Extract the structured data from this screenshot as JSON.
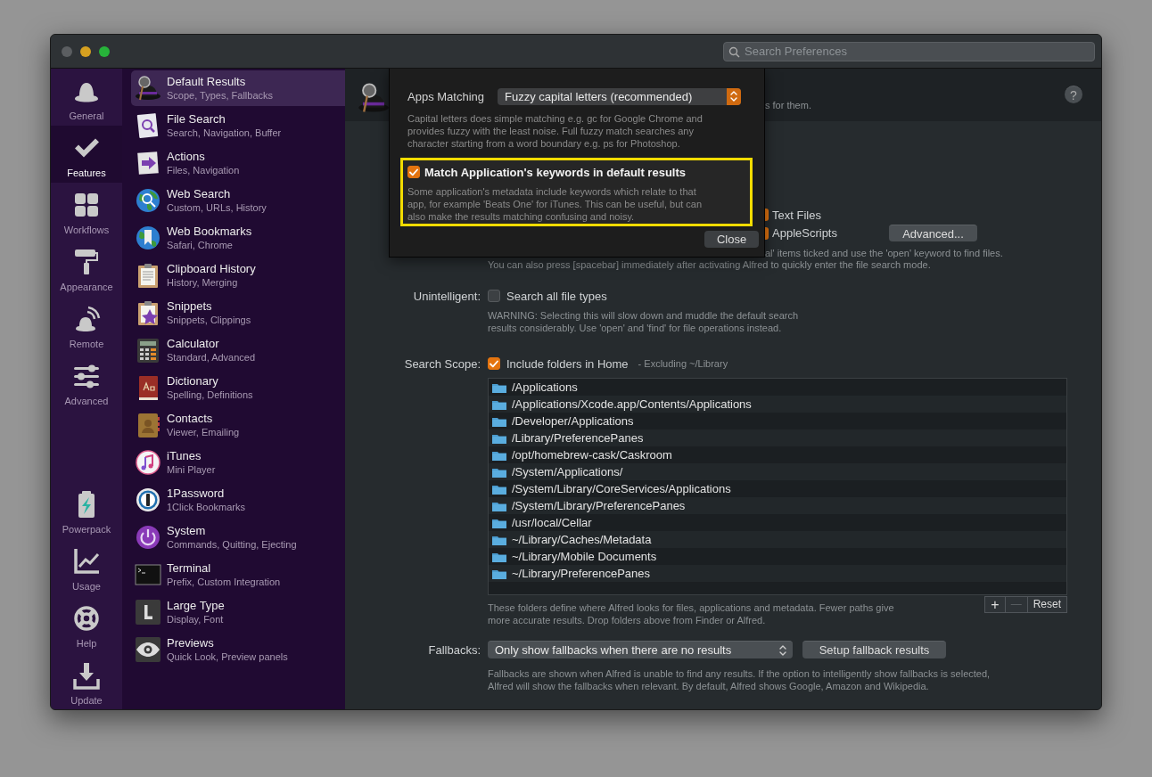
{
  "window": {
    "search": {
      "placeholder": "Search Preferences"
    }
  },
  "sidebar": {
    "items": [
      {
        "label": "General",
        "selected": false
      },
      {
        "label": "Features",
        "selected": true
      },
      {
        "label": "Workflows",
        "selected": false
      },
      {
        "label": "Appearance",
        "selected": false
      },
      {
        "label": "Remote",
        "selected": false
      },
      {
        "label": "Advanced",
        "selected": false
      }
    ],
    "bottom_items": [
      {
        "label": "Powerpack",
        "selected": false
      },
      {
        "label": "Usage",
        "selected": false
      },
      {
        "label": "Help",
        "selected": false
      },
      {
        "label": "Update",
        "selected": false
      }
    ]
  },
  "features": {
    "items": [
      {
        "title": "Default Results",
        "subtitle": "Scope, Types, Fallbacks",
        "selected": true
      },
      {
        "title": "File Search",
        "subtitle": "Search, Navigation, Buffer",
        "selected": false
      },
      {
        "title": "Actions",
        "subtitle": "Files, Navigation",
        "selected": false
      },
      {
        "title": "Web Search",
        "subtitle": "Custom, URLs, History",
        "selected": false
      },
      {
        "title": "Web Bookmarks",
        "subtitle": "Safari, Chrome",
        "selected": false
      },
      {
        "title": "Clipboard History",
        "subtitle": "History, Merging",
        "selected": false
      },
      {
        "title": "Snippets",
        "subtitle": "Snippets, Clippings",
        "selected": false
      },
      {
        "title": "Calculator",
        "subtitle": "Standard, Advanced",
        "selected": false
      },
      {
        "title": "Dictionary",
        "subtitle": "Spelling, Definitions",
        "selected": false
      },
      {
        "title": "Contacts",
        "subtitle": "Viewer, Emailing",
        "selected": false
      },
      {
        "title": "iTunes",
        "subtitle": "Mini Player",
        "selected": false
      },
      {
        "title": "1Password",
        "subtitle": "1Click Bookmarks",
        "selected": false
      },
      {
        "title": "System",
        "subtitle": "Commands, Quitting, Ejecting",
        "selected": false
      },
      {
        "title": "Terminal",
        "subtitle": "Prefix, Custom Integration",
        "selected": false
      },
      {
        "title": "Large Type",
        "subtitle": "Display, Font",
        "selected": false
      },
      {
        "title": "Previews",
        "subtitle": "Quick Look, Preview panels",
        "selected": false
      }
    ]
  },
  "header": {
    "text": "s for them.",
    "help_button": "?"
  },
  "file_types": [
    {
      "label": "Text Files",
      "checked": true
    },
    {
      "label": "AppleScripts",
      "checked": true
    }
  ],
  "advanced_button": "Advanced...",
  "file_types_notes": [
    "al' items ticked and use the 'open' keyword to find files.",
    "You can also press [spacebar] immediately after activating Alfred to quickly enter the file search mode."
  ],
  "unintelligent": {
    "label": "Unintelligent:",
    "option": "Search all file types",
    "checked": false,
    "note_lines": [
      "WARNING: Selecting this will slow down and muddle the default search",
      "results considerably. Use 'open' and 'find' for file operations instead."
    ]
  },
  "search_scope": {
    "label": "Search Scope:",
    "option": "Include folders in Home",
    "checked": true,
    "suffix": "- Excluding ~/Library",
    "folders": [
      "/Applications",
      "/Applications/Xcode.app/Contents/Applications",
      "/Developer/Applications",
      "/Library/PreferencePanes",
      "/opt/homebrew-cask/Caskroom",
      "/System/Applications/",
      "/System/Library/CoreServices/Applications",
      "/System/Library/PreferencePanes",
      "/usr/local/Cellar",
      "~/Library/Caches/Metadata",
      "~/Library/Mobile Documents",
      "~/Library/PreferencePanes"
    ],
    "buttons": [
      {
        "label": "+",
        "disabled": false
      },
      {
        "label": "—",
        "disabled": true
      },
      {
        "label": "Reset",
        "disabled": false
      }
    ],
    "note_lines": [
      "These folders define where Alfred looks for files, applications and metadata. Fewer paths give",
      "more accurate results. Drop folders above from Finder or Alfred."
    ]
  },
  "fallbacks": {
    "label": "Fallbacks:",
    "value": "Only show fallbacks when there are no results",
    "button": "Setup fallback results",
    "note_lines": [
      "Fallbacks are shown when Alfred is unable to find any results. If the option to intelligently show fallbacks is selected,",
      "Alfred will show the fallbacks when relevant. By default, Alfred shows Google, Amazon and Wikipedia."
    ]
  },
  "popup": {
    "label": "Apps Matching",
    "value": "Fuzzy capital letters (recommended)",
    "note_lines": [
      "Capital letters does simple matching e.g. gc for Google Chrome and",
      "provides fuzzy with the least noise. Full fuzzy match searches any",
      "character starting from a word boundary e.g. ps for Photoshop."
    ],
    "option": {
      "label": "Match Application's keywords in default results",
      "checked": true,
      "highlighted": true,
      "note_lines": [
        "Some application's metadata include keywords which relate to that",
        "app, for example 'Beats One' for iTunes. This can be useful, but can",
        "also make the results matching confusing and noisy."
      ]
    },
    "close_button": "Close"
  }
}
